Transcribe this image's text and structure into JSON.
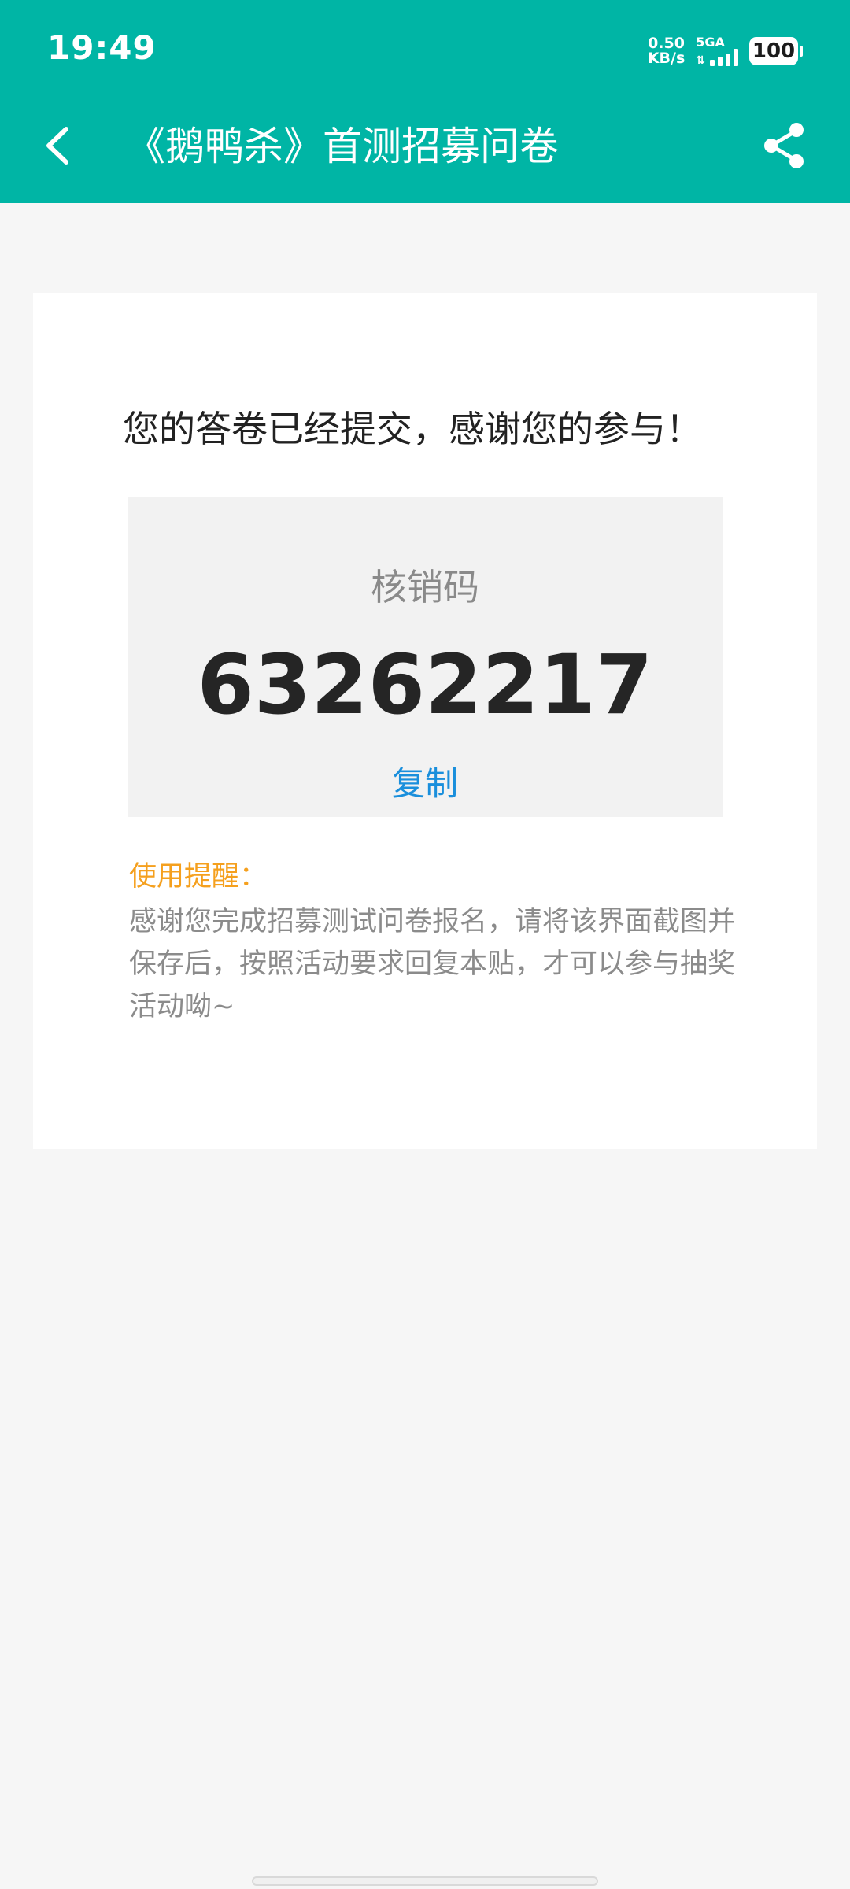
{
  "status_bar": {
    "time": "19:49",
    "net_speed_value": "0.50",
    "net_speed_unit": "KB/s",
    "network_type": "5GA",
    "battery": "100"
  },
  "header": {
    "title": "《鹅鸭杀》首测招募问卷",
    "back_icon": "chevron-left-icon",
    "share_icon": "share-icon",
    "background_color": "#00b5a5"
  },
  "result": {
    "thanks_message": "您的答卷已经提交，感谢您的参与！",
    "code_label": "核销码",
    "code_value": "63262217",
    "copy_label": "复制",
    "tip_title": "使用提醒：",
    "tip_text": "感谢您完成招募测试问卷报名，请将该界面截图并保存后，按照活动要求回复本贴，才可以参与抽奖活动呦~",
    "tip_title_color": "#f5a01e",
    "copy_color": "#1a8fdc"
  }
}
